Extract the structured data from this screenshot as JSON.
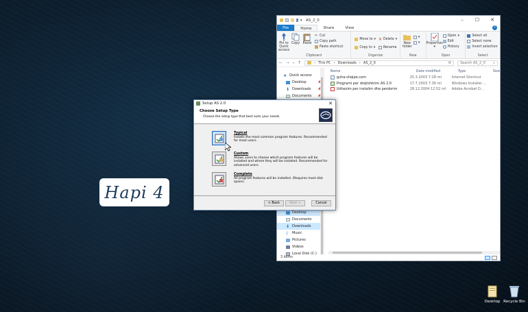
{
  "overlay": {
    "step_label": "Hapi 4"
  },
  "explorer": {
    "title": "AS_2_0",
    "tabs": [
      "File",
      "Home",
      "Share",
      "View"
    ],
    "ribbon": {
      "clipboard": {
        "name": "Clipboard",
        "pin": "Pin to Quick access",
        "copy": "Copy",
        "paste": "Paste",
        "cut": "Cut",
        "copy_path": "Copy path",
        "paste_shortcut": "Paste shortcut"
      },
      "organize": {
        "name": "Organize",
        "move_to": "Move to",
        "copy_to": "Copy to",
        "delete": "Delete",
        "rename": "Rename"
      },
      "new": {
        "name": "New",
        "new_folder": "New folder"
      },
      "open": {
        "name": "Open",
        "properties": "Properties",
        "open": "Open",
        "edit": "Edit",
        "history": "History"
      },
      "select": {
        "name": "Select",
        "select_all": "Select all",
        "select_none": "Select none",
        "invert": "Invert selection"
      }
    },
    "address": {
      "parts": [
        "This PC",
        "Downloads",
        "AS_2_0"
      ],
      "search_placeholder": "Search AS_2_0"
    },
    "nav": {
      "top": [
        {
          "label": "Quick access"
        },
        {
          "label": "Desktop"
        },
        {
          "label": "Downloads"
        },
        {
          "label": "Documents"
        }
      ],
      "bottom": [
        {
          "label": "Desktop"
        },
        {
          "label": "Documents"
        },
        {
          "label": "Downloads"
        },
        {
          "label": "Music"
        },
        {
          "label": "Pictures"
        },
        {
          "label": "Videos"
        },
        {
          "label": "Local Disk (C:)"
        }
      ]
    },
    "columns": [
      "Name",
      "Date modified",
      "Type",
      "Size"
    ],
    "files": [
      {
        "name": "guha-shqipe.com",
        "date": "25.3.2003 7:28 ml",
        "type": "Internet Shortcut"
      },
      {
        "name": "Programi per drejtshkrim AS 2.0",
        "date": "17.7.2003 7:36 ml",
        "type": "Windows Installer ..."
      },
      {
        "name": "Udhezim per instalim dhe perdorim",
        "date": "28.12.2004 12:52 ml",
        "type": "Adobe Acrobat D..."
      }
    ],
    "status": "3 items"
  },
  "dialog": {
    "title": "Setup AS 2.0",
    "heading": "Choose Setup Type",
    "subheading": "Choose the setup type that best suits your needs.",
    "options": [
      {
        "title": "Typical",
        "desc": "Installs the most common program features. Recommended for most users."
      },
      {
        "title": "Custom",
        "desc": "Allows users to choose which program features will be installed and where they will be installed. Recommended for advanced users."
      },
      {
        "title": "Complete",
        "desc": "All program features will be installed.  (Requires most disk space)"
      }
    ],
    "buttons": {
      "back": "< Back",
      "next": "Next >",
      "cancel": "Cancel"
    }
  },
  "desktop_icons": [
    {
      "label": "Desktop"
    },
    {
      "label": "Recycle Bin"
    }
  ]
}
